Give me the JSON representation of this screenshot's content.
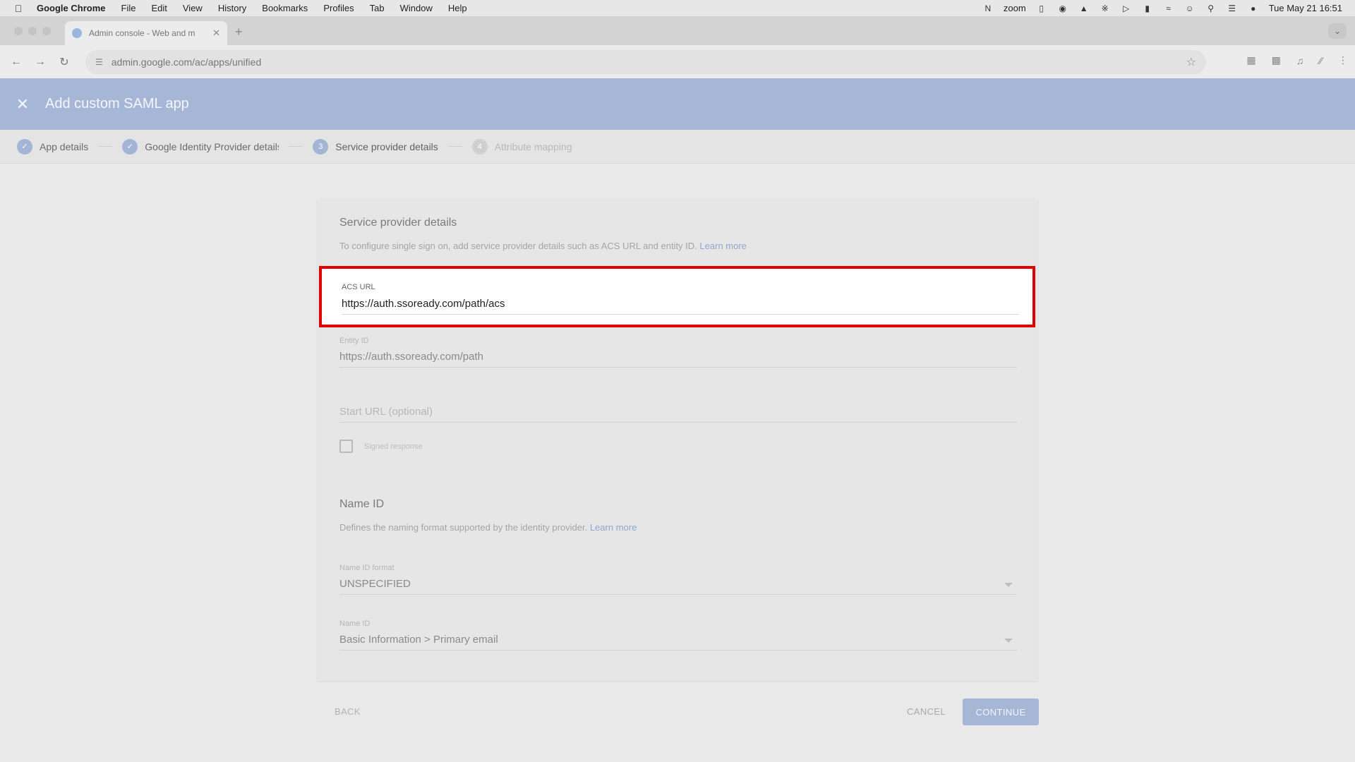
{
  "menubar": {
    "app_name": "Google Chrome",
    "items": [
      "File",
      "Edit",
      "View",
      "History",
      "Bookmarks",
      "Profiles",
      "Tab",
      "Window",
      "Help"
    ],
    "zoom_label": "zoom",
    "datetime": "Tue May 21  16:51"
  },
  "browser": {
    "tab_title": "Admin console - Web and m",
    "url": "admin.google.com/ac/apps/unified"
  },
  "header": {
    "title": "Add custom SAML app"
  },
  "stepper": {
    "steps": [
      {
        "number": "1",
        "label": "App details",
        "state": "done"
      },
      {
        "number": "2",
        "label": "Google Identity Provider details",
        "state": "done"
      },
      {
        "number": "3",
        "label": "Service provider details",
        "state": "active"
      },
      {
        "number": "4",
        "label": "Attribute mapping",
        "state": "pending"
      }
    ]
  },
  "service_provider": {
    "title": "Service provider details",
    "description": "To configure single sign on, add service provider details such as ACS URL and entity ID.",
    "learn_more": "Learn more",
    "acs_url_label": "ACS URL",
    "acs_url_value": "https://auth.ssoready.com/path/acs",
    "entity_id_label": "Entity ID",
    "entity_id_value": "https://auth.ssoready.com/path",
    "start_url_placeholder": "Start URL (optional)",
    "signed_response_label": "Signed response"
  },
  "name_id": {
    "title": "Name ID",
    "description": "Defines the naming format supported by the identity provider.",
    "learn_more": "Learn more",
    "format_label": "Name ID format",
    "format_value": "UNSPECIFIED",
    "name_id_label": "Name ID",
    "name_id_value": "Basic Information > Primary email"
  },
  "footer": {
    "back": "BACK",
    "cancel": "CANCEL",
    "continue": "CONTINUE"
  },
  "colors": {
    "accent": "#a6b6d6",
    "highlight_border": "#e10000"
  }
}
